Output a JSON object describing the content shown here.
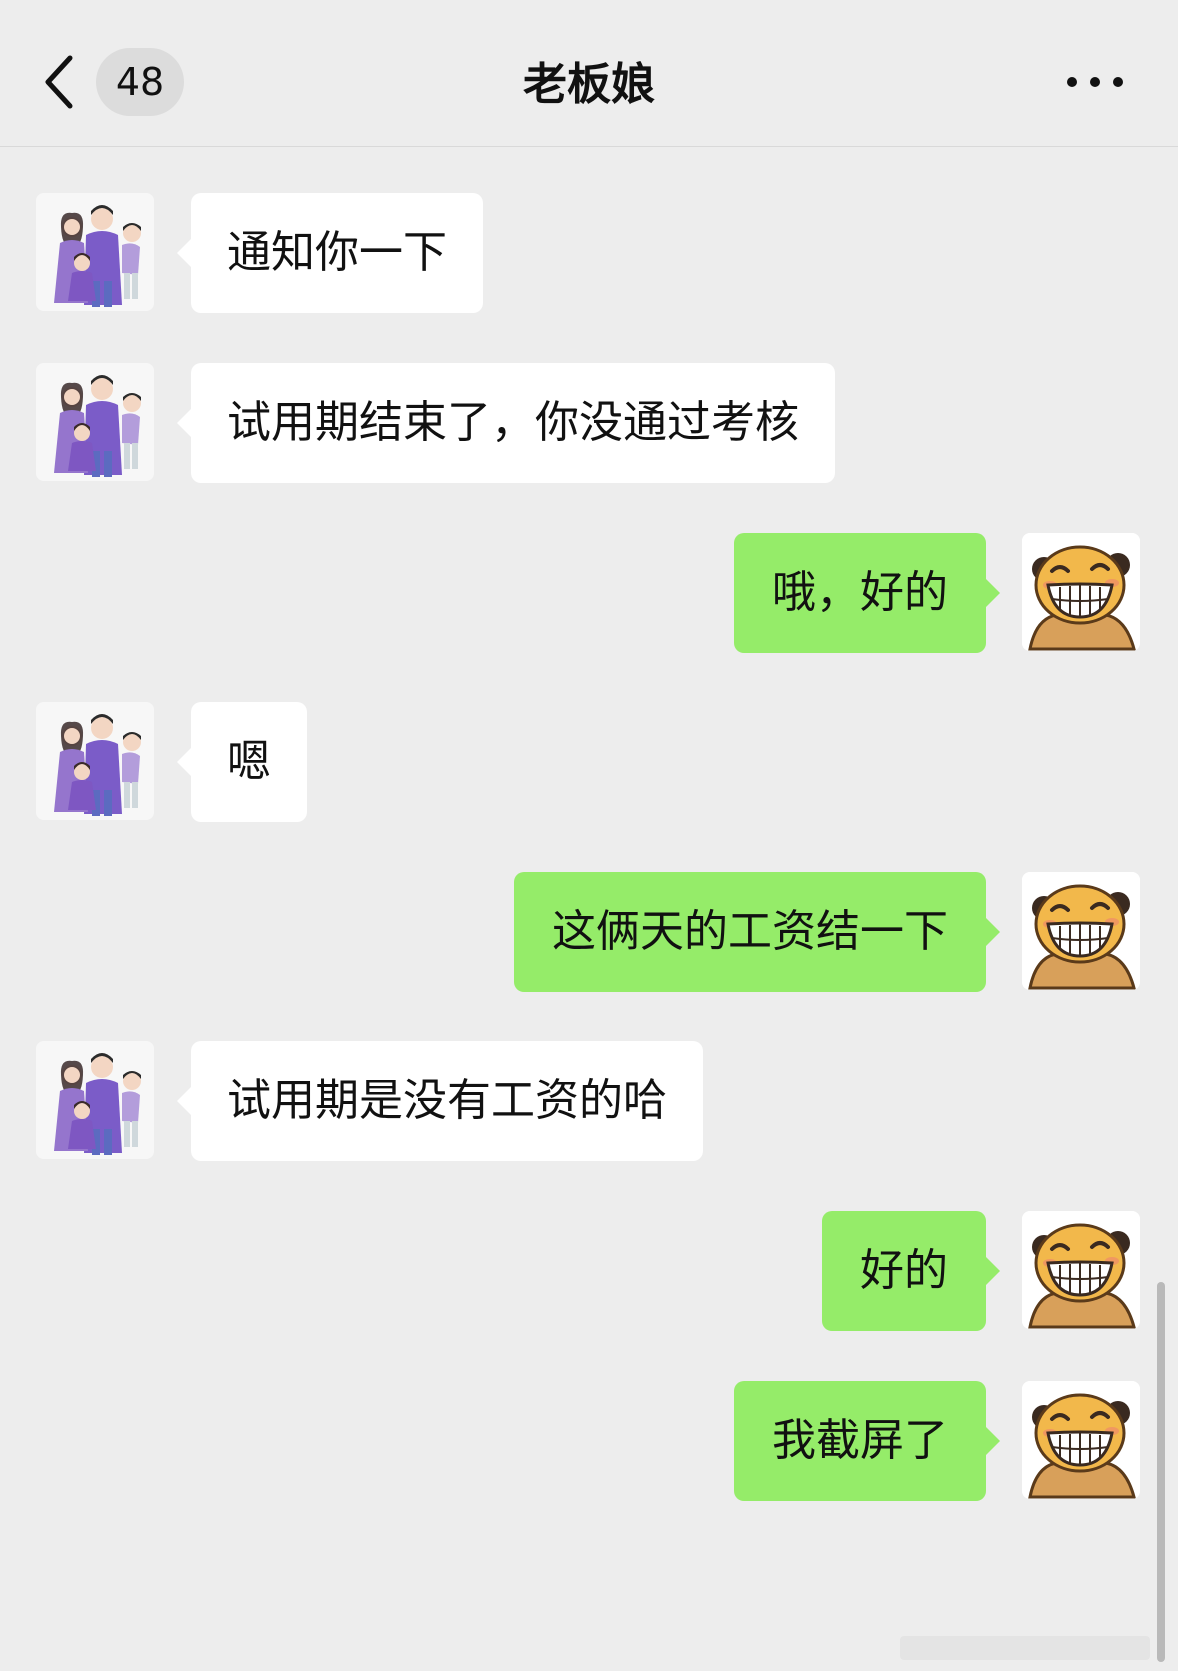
{
  "header": {
    "back_icon": "chevron-left-icon",
    "unread_count": "48",
    "title": "老板娘",
    "more_icon": "more-dots-icon"
  },
  "colors": {
    "background": "#ededed",
    "incoming_bubble": "#ffffff",
    "outgoing_bubble": "#95ec69"
  },
  "messages": [
    {
      "from": "contact",
      "text": "通知你一下",
      "avatar": "family-avatar"
    },
    {
      "from": "contact",
      "text": "试用期结束了，你没通过考核",
      "avatar": "family-avatar"
    },
    {
      "from": "me",
      "text": "哦，好的",
      "avatar": "grinning-bear-avatar"
    },
    {
      "from": "contact",
      "text": "嗯",
      "avatar": "family-avatar"
    },
    {
      "from": "me",
      "text": "这俩天的工资结一下",
      "avatar": "grinning-bear-avatar"
    },
    {
      "from": "contact",
      "text": "试用期是没有工资的哈",
      "avatar": "family-avatar"
    },
    {
      "from": "me",
      "text": "好的",
      "avatar": "grinning-bear-avatar"
    },
    {
      "from": "me",
      "text": "我截屏了",
      "avatar": "grinning-bear-avatar"
    }
  ]
}
